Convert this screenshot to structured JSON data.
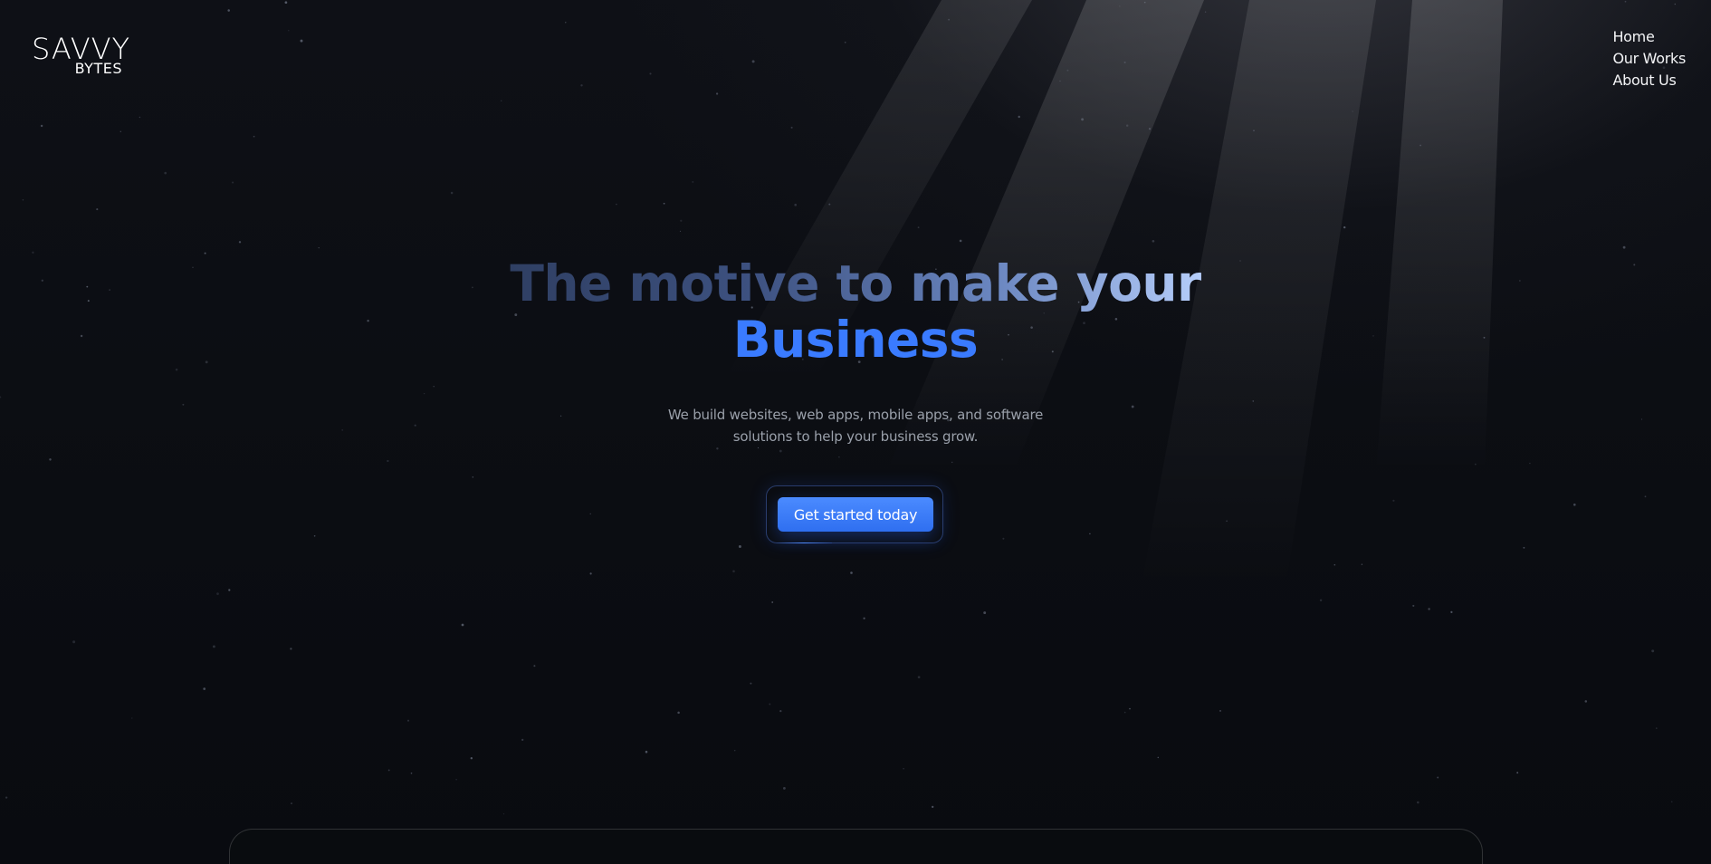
{
  "brand": {
    "logo_main": "SAVVY",
    "logo_sub": "BYTES"
  },
  "nav": {
    "items": [
      {
        "label": "Home"
      },
      {
        "label": "Our Works"
      },
      {
        "label": "About Us"
      }
    ]
  },
  "hero": {
    "headline_line1": "The motive to make your",
    "headline_line2": "Business",
    "subtitle": "We build websites, web apps, mobile apps, and software solutions to help your business grow.",
    "cta_label": "Get started today"
  },
  "colors": {
    "background": "#0b0d12",
    "accent": "#3a7bff",
    "text_primary": "#ffffff",
    "text_muted": "#9aa0aa"
  },
  "icons": {
    "logo": "savvy-bytes-logo"
  }
}
